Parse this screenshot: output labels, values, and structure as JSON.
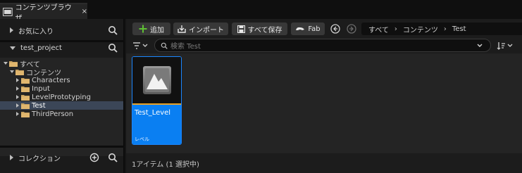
{
  "tab": {
    "title": "コンテンツブラウザ",
    "close": "×"
  },
  "sidebar": {
    "favorites_label": "お気に入り",
    "project_label": "test_project",
    "tree": [
      {
        "label": "すべて",
        "level": 0,
        "expanded": true,
        "selected": false
      },
      {
        "label": "コンテンツ",
        "level": 1,
        "expanded": true,
        "selected": false
      },
      {
        "label": "Characters",
        "level": 2,
        "expanded": false,
        "selected": false
      },
      {
        "label": "Input",
        "level": 2,
        "expanded": false,
        "selected": false
      },
      {
        "label": "LevelPrototyping",
        "level": 2,
        "expanded": false,
        "selected": false
      },
      {
        "label": "Test",
        "level": 2,
        "expanded": false,
        "selected": true
      },
      {
        "label": "ThirdPerson",
        "level": 2,
        "expanded": false,
        "selected": false
      }
    ],
    "collections_label": "コレクション"
  },
  "toolbar": {
    "add_label": "追加",
    "import_label": "インポート",
    "save_all_label": "すべて保存",
    "fab_label": "Fab"
  },
  "breadcrumb": [
    "すべて",
    "コンテンツ",
    "Test"
  ],
  "breadcrumb_separator": "›",
  "search": {
    "placeholder": "検索 Test"
  },
  "assets": [
    {
      "name": "Test_Level",
      "type": "レベル",
      "selected": true
    }
  ],
  "status_text": "1アイテム (1 選択中)",
  "colors": {
    "accent": "#0a7ff2",
    "add_green": "#5fc134",
    "level_bar": "#e8a227",
    "selected_row": "#3b4657"
  },
  "icons": {
    "tab": "content-browser-icon",
    "search": "search-icon",
    "add": "plus-icon",
    "import": "import-icon",
    "save": "save-icon",
    "fab": "fab-icon",
    "back": "back-arrow-icon",
    "forward": "forward-arrow-icon",
    "filter": "filter-icon",
    "sort": "sort-icon",
    "folder": "folder-icon",
    "level": "level-icon"
  }
}
